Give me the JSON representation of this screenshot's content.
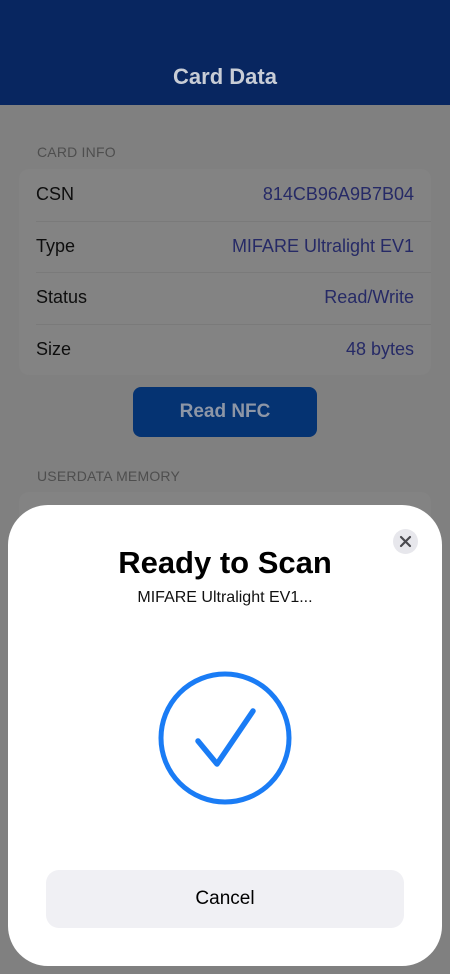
{
  "header": {
    "title": "Card Data"
  },
  "card_info": {
    "section_label": "CARD INFO",
    "rows": [
      {
        "label": "CSN",
        "value": "814CB96A9B7B04"
      },
      {
        "label": "Type",
        "value": "MIFARE Ultralight EV1"
      },
      {
        "label": "Status",
        "value": "Read/Write"
      },
      {
        "label": "Size",
        "value": "48 bytes"
      }
    ]
  },
  "read_button": {
    "label": "Read NFC"
  },
  "userdata": {
    "section_label": "USERDATA MEMORY"
  },
  "sheet": {
    "title": "Ready to Scan",
    "subtitle": "MIFARE Ultralight EV1...",
    "status_icon": "checkmark-circle-icon",
    "close_icon": "close-icon",
    "cancel_label": "Cancel",
    "accent_color": "#1a7cf5"
  }
}
